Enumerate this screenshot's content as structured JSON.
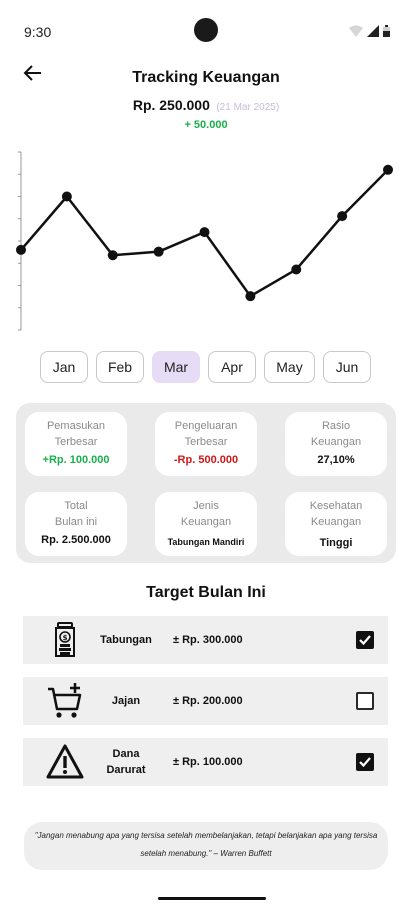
{
  "status": {
    "time": "9:30"
  },
  "header": {
    "title": "Tracking Keuangan",
    "amount": "Rp. 250.000",
    "date": "(21 Mar 2025)",
    "change": "+ 50.000"
  },
  "chart_data": {
    "type": "line",
    "x": [
      1,
      2,
      3,
      4,
      5,
      6,
      7,
      8,
      9
    ],
    "values": [
      45,
      75,
      42,
      44,
      55,
      19,
      34,
      64,
      90
    ],
    "ylim": [
      0,
      100
    ],
    "grid": false,
    "color": "#111111"
  },
  "months": [
    {
      "label": "Jan",
      "active": false
    },
    {
      "label": "Feb",
      "active": false
    },
    {
      "label": "Mar",
      "active": true
    },
    {
      "label": "Apr",
      "active": false
    },
    {
      "label": "May",
      "active": false
    },
    {
      "label": "Jun",
      "active": false
    }
  ],
  "stats": [
    {
      "label": "Pemasukan\nTerbesar",
      "value": "+Rp. 100.000",
      "tone": "green"
    },
    {
      "label": "Pengeluaran\nTerbesar",
      "value": "-Rp. 500.000",
      "tone": "red"
    },
    {
      "label": "Rasio\nKeuangan",
      "value": "27,10%",
      "tone": ""
    },
    {
      "label": "Total\nBulan ini",
      "value": "Rp. 2.500.000",
      "tone": ""
    },
    {
      "label": "Jenis\nKeuangan",
      "value": "Tabungan Mandiri",
      "tone": ""
    },
    {
      "label": "Kesehatan\nKeuangan",
      "value": "Tinggi",
      "tone": ""
    }
  ],
  "targets": {
    "title": "Target Bulan Ini",
    "items": [
      {
        "icon": "savings-jar-icon",
        "name": "Tabungan",
        "amount": "± Rp. 300.000",
        "checked": true
      },
      {
        "icon": "add-to-cart-icon",
        "name": "Jajan",
        "amount": "± Rp. 200.000",
        "checked": false
      },
      {
        "icon": "warning-icon",
        "name": "Dana\nDarurat",
        "amount": "± Rp. 100.000",
        "checked": true
      }
    ]
  },
  "quote": {
    "text": "\"Jangan menabung apa yang tersisa setelah membelanjakan, tetapi belanjakan apa yang tersisa setelah menabung.\" – Warren Buffett"
  },
  "colors": {
    "accent": "#e6dcf5",
    "positive": "#18b04a",
    "negative": "#d01818",
    "panel": "#eaeaea"
  }
}
